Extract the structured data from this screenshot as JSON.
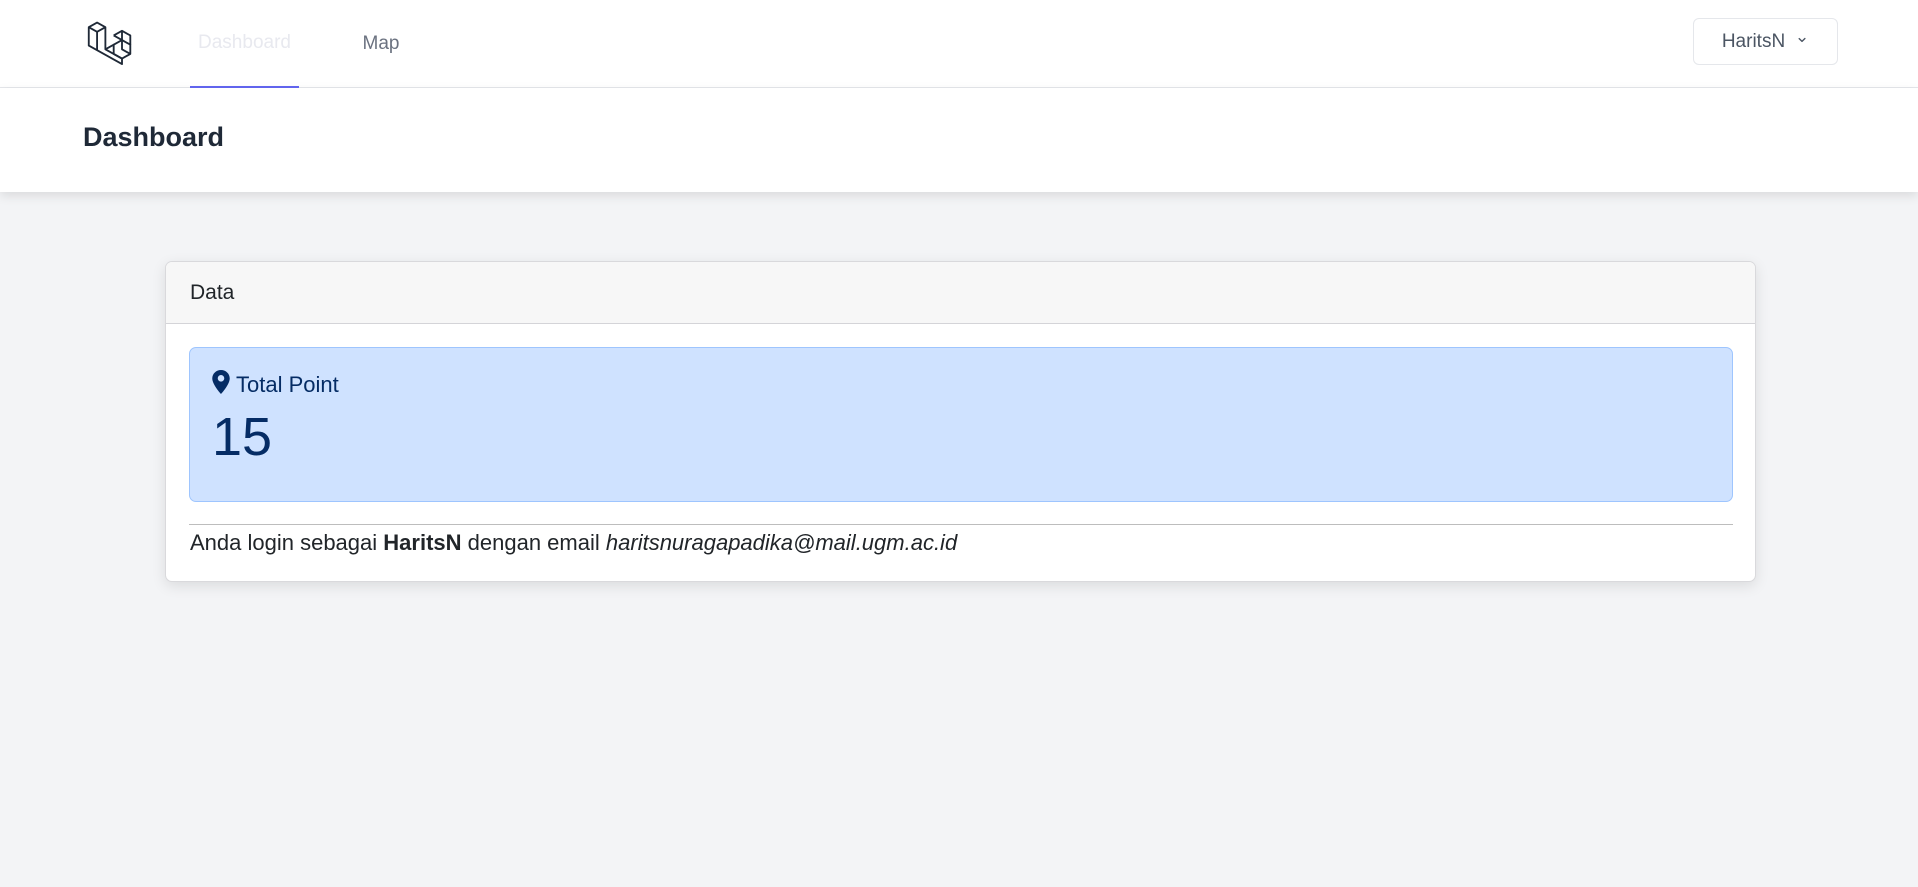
{
  "nav": {
    "logo_icon": "laravel-logo-icon",
    "links": [
      {
        "label": "Dashboard",
        "active": true
      },
      {
        "label": "Map",
        "active": false
      }
    ],
    "user_menu": {
      "label": "HaritsN",
      "icon": "chevron-down-icon"
    }
  },
  "header": {
    "title": "Dashboard"
  },
  "card": {
    "title": "Data",
    "stat": {
      "icon": "map-pin-icon",
      "label": "Total Point",
      "value": "15"
    },
    "login_info": {
      "prefix": "Anda login sebagai",
      "username": "HaritsN",
      "middle": "dengan email",
      "email": "haritsnuragapadika@mail.ugm.ac.id"
    }
  },
  "colors": {
    "accent": "#6366f1",
    "alert_bg": "#cfe2ff",
    "alert_text": "#052c65",
    "page_bg": "#f3f4f6"
  }
}
